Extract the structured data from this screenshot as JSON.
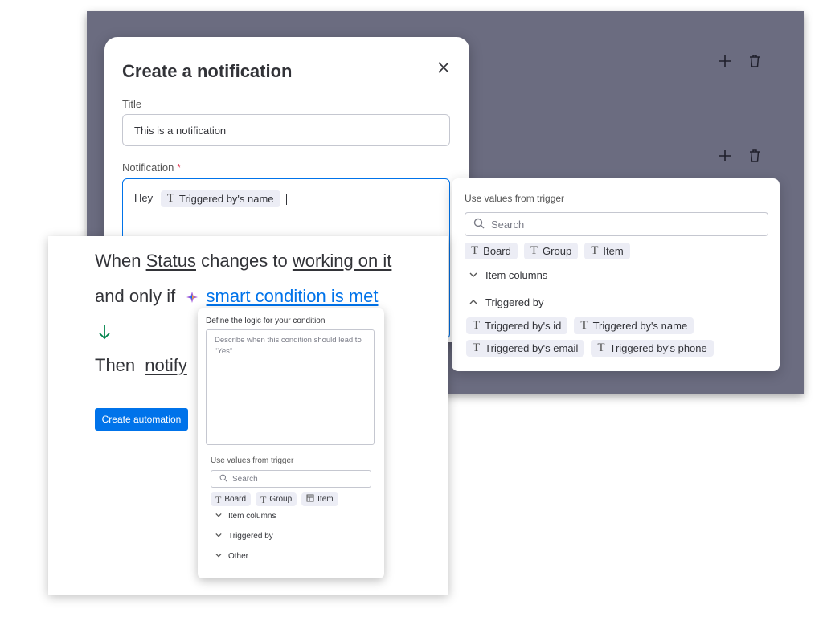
{
  "background_rows": [
    {
      "add": "+",
      "delete": "delete"
    },
    {
      "add": "+",
      "delete": "delete"
    }
  ],
  "modal": {
    "title": "Create a notification",
    "title_label": "Title",
    "title_value": "This is a notification",
    "notification_label": "Notification",
    "required_mark": "*",
    "notification_text": "Hey",
    "notification_chip": "Triggered by's name"
  },
  "dropdown": {
    "label": "Use values from trigger",
    "search_placeholder": "Search",
    "chips": [
      "Board",
      "Group",
      "Item"
    ],
    "item_columns": "Item columns",
    "triggered_by": "Triggered by",
    "triggered_chips": [
      "Triggered by's id",
      "Triggered by's name",
      "Triggered by's email",
      "Triggered by's phone"
    ]
  },
  "automation": {
    "line1": {
      "when": "When",
      "status": "Status",
      "changes_to": "changes to",
      "value": "working on it"
    },
    "line2": {
      "and_only_if": "and only if",
      "condition": "smart condition is met"
    },
    "line3": {
      "then": "Then",
      "action": "notify"
    },
    "create_button": "Create automation"
  },
  "condition_panel": {
    "label": "Define the logic for your condition",
    "placeholder": "Describe when this condition should lead to \"Yes\"",
    "trigger_label": "Use values from trigger",
    "search_placeholder": "Search",
    "chips": [
      "Board",
      "Group",
      "Item"
    ],
    "sections": [
      "Item columns",
      "Triggered by",
      "Other"
    ]
  },
  "colors": {
    "accent": "#0073ea",
    "background_panel": "#6b6c80",
    "chip_bg": "#ecedf5",
    "arrow_green": "#00854d"
  }
}
